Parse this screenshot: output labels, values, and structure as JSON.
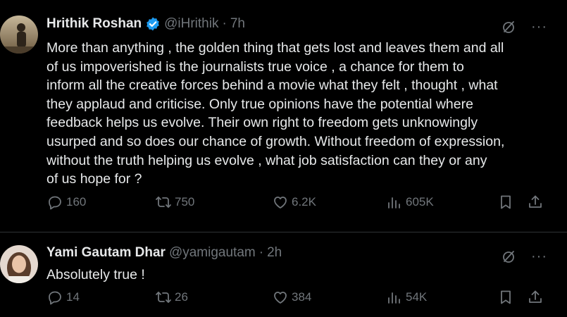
{
  "tweets": [
    {
      "name": "Hrithik Roshan",
      "handle": "@iHrithik",
      "time": "7h",
      "verified": true,
      "text": "More than anything , the golden thing that gets lost and leaves them and all\nof us impoverished is the journalists true voice , a chance for them to\ninform all the creative forces behind a movie what they felt , thought , what\nthey applaud and criticise. Only true opinions have the potential where\nfeedback helps us evolve. Their own right to freedom gets unknowingly\nusurped and so does our chance of growth. Without freedom of expression,\nwithout the truth helping us evolve , what job satisfaction can they or any\nof us hope for ?",
      "replies": "160",
      "retweets": "750",
      "likes": "6.2K",
      "views": "605K"
    },
    {
      "name": "Yami Gautam Dhar",
      "handle": "@yamigautam",
      "time": "2h",
      "verified": false,
      "text": "Absolutely true !",
      "replies": "14",
      "retweets": "26",
      "likes": "384",
      "views": "54K"
    }
  ],
  "ui": {
    "dot": "·",
    "more": "···"
  },
  "icons": [
    "grok-icon",
    "more-icon",
    "reply-icon",
    "retweet-icon",
    "like-icon",
    "views-icon",
    "bookmark-icon",
    "share-icon",
    "verified-icon"
  ],
  "colors": {
    "background": "#000000",
    "text": "#e7e9ea",
    "muted": "#71767b",
    "verified": "#1d9bf0",
    "separator": "#2f3336"
  }
}
